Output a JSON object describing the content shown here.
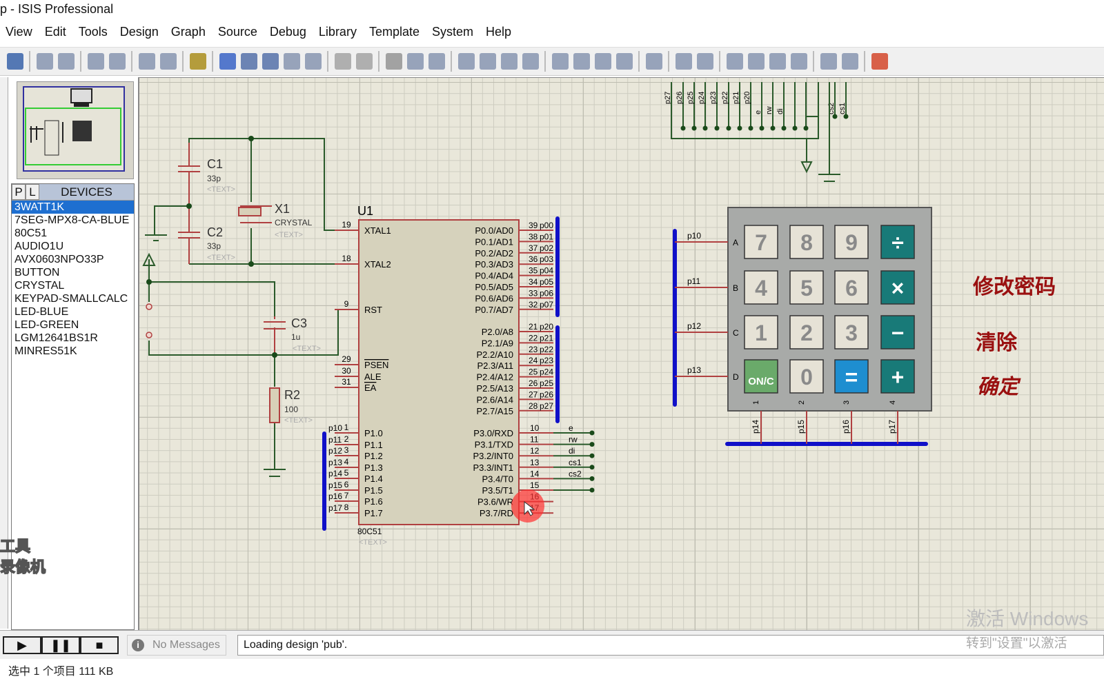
{
  "window": {
    "title": "p - ISIS Professional"
  },
  "menu": [
    "View",
    "Edit",
    "Tools",
    "Design",
    "Graph",
    "Source",
    "Debug",
    "Library",
    "Template",
    "System",
    "Help"
  ],
  "toolbar": {
    "icons": [
      "save-icon",
      "|",
      "import-icon",
      "export-icon",
      "|",
      "print-icon",
      "print-area-icon",
      "|",
      "refresh-icon",
      "grid-icon",
      "|",
      "origin-icon",
      "|",
      "pan-icon",
      "zoom-in-icon",
      "zoom-out-icon",
      "zoom-all-icon",
      "zoom-area-icon",
      "|",
      "undo-icon",
      "redo-icon",
      "|",
      "cut-icon",
      "copy-icon",
      "paste-icon",
      "|",
      "block-copy-icon",
      "block-move-icon",
      "block-rotate-icon",
      "block-delete-icon",
      "|",
      "pick-device-icon",
      "make-device-icon",
      "package-tool-icon",
      "decompose-icon",
      "|",
      "wire-autorouter-icon",
      "|",
      "search-tag-icon",
      "property-assign-icon",
      "|",
      "new-sheet-icon",
      "add-sheet-icon",
      "remove-sheet-icon",
      "goto-child-icon",
      "|",
      "bill-of-materials-icon",
      "electrical-rule-check-icon",
      "|",
      "ares-icon"
    ],
    "colors": {
      "default": "#7a8aa8",
      "save-icon": "#2050a0",
      "ares-icon": "#d03010",
      "zoom-in-icon": "#4060a0",
      "zoom-out-icon": "#4060a0",
      "pan-icon": "#2050c0",
      "origin-icon": "#a08000",
      "cut-icon": "#888",
      "undo-icon": "#999",
      "redo-icon": "#999"
    }
  },
  "devices": {
    "tab_p": "P",
    "tab_l": "L",
    "title": "DEVICES",
    "selected": 0,
    "items": [
      "3WATT1K",
      "7SEG-MPX8-CA-BLUE",
      "80C51",
      "AUDIO1U",
      "AVX0603NPO33P",
      "BUTTON",
      "CRYSTAL",
      "KEYPAD-SMALLCALC",
      "LED-BLUE",
      "LED-GREEN",
      "LGM12641BS1R",
      "MINRES51K"
    ]
  },
  "schematic": {
    "c1": {
      "ref": "C1",
      "value": "33p",
      "text": "<TEXT>"
    },
    "c2": {
      "ref": "C2",
      "value": "33p",
      "text": "<TEXT>"
    },
    "x1": {
      "ref": "X1",
      "value": "CRYSTAL",
      "text": "<TEXT>"
    },
    "c3": {
      "ref": "C3",
      "value": "1u",
      "text": "<TEXT>"
    },
    "r2": {
      "ref": "R2",
      "value": "100",
      "text": "<TEXT>"
    },
    "u1": {
      "ref": "U1",
      "part": "80C51",
      "text": "<TEXT>",
      "left_pins": [
        {
          "num": "19",
          "name": "XTAL1",
          "net": ""
        },
        {
          "num": "18",
          "name": "XTAL2",
          "net": ""
        },
        {
          "num": "9",
          "name": "RST",
          "net": ""
        },
        {
          "num": "29",
          "name": "PSEN",
          "net": "",
          "bar": true
        },
        {
          "num": "30",
          "name": "ALE",
          "net": ""
        },
        {
          "num": "31",
          "name": "EA",
          "net": "",
          "bar": true
        },
        {
          "num": "1",
          "name": "P1.0",
          "net": "p10"
        },
        {
          "num": "2",
          "name": "P1.1",
          "net": "p11"
        },
        {
          "num": "3",
          "name": "P1.2",
          "net": "p12"
        },
        {
          "num": "4",
          "name": "P1.3",
          "net": "p13"
        },
        {
          "num": "5",
          "name": "P1.4",
          "net": "p14"
        },
        {
          "num": "6",
          "name": "P1.5",
          "net": "p15"
        },
        {
          "num": "7",
          "name": "P1.6",
          "net": "p16"
        },
        {
          "num": "8",
          "name": "P1.7",
          "net": "p17"
        }
      ],
      "right_pins": [
        {
          "num": "39",
          "name": "P0.0/AD0",
          "net": "p00"
        },
        {
          "num": "38",
          "name": "P0.1/AD1",
          "net": "p01"
        },
        {
          "num": "37",
          "name": "P0.2/AD2",
          "net": "p02"
        },
        {
          "num": "36",
          "name": "P0.3/AD3",
          "net": "p03"
        },
        {
          "num": "35",
          "name": "P0.4/AD4",
          "net": "p04"
        },
        {
          "num": "34",
          "name": "P0.5/AD5",
          "net": "p05"
        },
        {
          "num": "33",
          "name": "P0.6/AD6",
          "net": "p06"
        },
        {
          "num": "32",
          "name": "P0.7/AD7",
          "net": "p07"
        },
        {
          "num": "21",
          "name": "P2.0/A8",
          "net": "p20"
        },
        {
          "num": "22",
          "name": "P2.1/A9",
          "net": "p21"
        },
        {
          "num": "23",
          "name": "P2.2/A10",
          "net": "p22"
        },
        {
          "num": "24",
          "name": "P2.3/A11",
          "net": "p23"
        },
        {
          "num": "25",
          "name": "P2.4/A12",
          "net": "p24"
        },
        {
          "num": "26",
          "name": "P2.5/A13",
          "net": "p25"
        },
        {
          "num": "27",
          "name": "P2.6/A14",
          "net": "p26"
        },
        {
          "num": "28",
          "name": "P2.7/A15",
          "net": "p27"
        },
        {
          "num": "10",
          "name": "P3.0/RXD",
          "net": "e"
        },
        {
          "num": "11",
          "name": "P3.1/TXD",
          "net": "rw"
        },
        {
          "num": "12",
          "name": "P3.2/INT0",
          "net": "di"
        },
        {
          "num": "13",
          "name": "P3.3/INT1",
          "net": "cs1"
        },
        {
          "num": "14",
          "name": "P3.4/T0",
          "net": "cs2"
        },
        {
          "num": "15",
          "name": "P3.5/T1",
          "net": ""
        },
        {
          "num": "16",
          "name": "P3.6/WR",
          "net": ""
        },
        {
          "num": "17",
          "name": "P3.7/RD",
          "net": ""
        }
      ]
    },
    "top_nets": [
      "p27",
      "p26",
      "p25",
      "p24",
      "p23",
      "p22",
      "p21",
      "p20",
      "e",
      "rw",
      "di",
      "",
      "",
      "cs2",
      "cs1"
    ],
    "keypad": {
      "rows": [
        "A",
        "B",
        "C",
        "D"
      ],
      "cols": [
        "1",
        "2",
        "3",
        "4"
      ],
      "row_nets": [
        "p10",
        "p11",
        "p12",
        "p13"
      ],
      "col_nets": [
        "p14",
        "p15",
        "p16",
        "p17"
      ],
      "keys": [
        [
          "7",
          "8",
          "9",
          "÷"
        ],
        [
          "4",
          "5",
          "6",
          "×"
        ],
        [
          "1",
          "2",
          "3",
          "−"
        ],
        [
          "ON/C",
          "0",
          "=",
          "+"
        ]
      ]
    },
    "annotations": [
      "修改密码",
      "清除",
      "确定"
    ]
  },
  "simulation": {
    "play": "play",
    "pause": "pause",
    "stop": "stop"
  },
  "messages": "No Messages",
  "status": "Loading design 'pub'.",
  "footer": "选中 1 个项目  111 KB",
  "overlay": {
    "recorder": [
      "工具",
      "录像机"
    ],
    "watermark_line1": "激活 Windows",
    "watermark_line2": "转到\"设置\"以激活"
  }
}
